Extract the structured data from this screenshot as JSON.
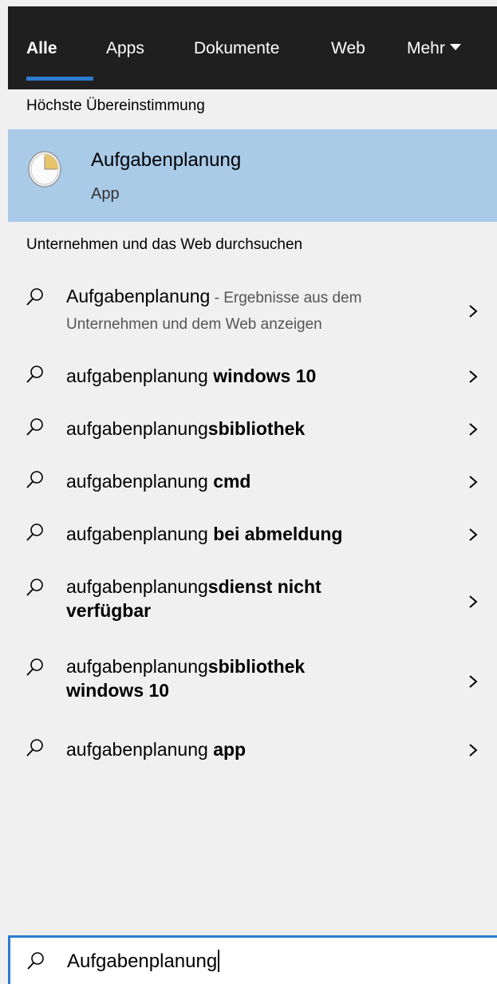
{
  "tabs": [
    {
      "label": "Alle",
      "active": true
    },
    {
      "label": "Apps",
      "active": false
    },
    {
      "label": "Dokumente",
      "active": false
    },
    {
      "label": "Web",
      "active": false
    },
    {
      "label": "Mehr",
      "active": false
    }
  ],
  "best_match": {
    "header": "Höchste Übereinstimmung",
    "title": "Aufgabenplanung",
    "subtitle": "App",
    "icon": "task-scheduler-clock-icon"
  },
  "web_section": {
    "header": "Unternehmen und das Web durchsuchen",
    "items": [
      {
        "prefix": "Aufgabenplanung",
        "bold": "",
        "secondary": " - Ergebnisse aus dem Unternehmen und dem Web anzeigen"
      },
      {
        "prefix": "aufgabenplanung ",
        "bold": "windows 10",
        "secondary": ""
      },
      {
        "prefix": "aufgabenplanung",
        "bold": "sbibliothek",
        "secondary": ""
      },
      {
        "prefix": "aufgabenplanung ",
        "bold": "cmd",
        "secondary": ""
      },
      {
        "prefix": "aufgabenplanung ",
        "bold": "bei abmeldung",
        "secondary": ""
      },
      {
        "prefix": "aufgabenplanung",
        "bold": "sdienst nicht verfügbar",
        "secondary": ""
      },
      {
        "prefix": "aufgabenplanung",
        "bold": "sbibliothek windows 10",
        "secondary": ""
      },
      {
        "prefix": "aufgabenplanung ",
        "bold": "app",
        "secondary": ""
      }
    ]
  },
  "search": {
    "value": "Aufgabenplanung"
  },
  "colors": {
    "tabbar_bg": "#1f1f1f",
    "accent": "#2a7bd1",
    "selected_bg": "#a9cbe8",
    "panel_bg": "#f0f0f0"
  }
}
